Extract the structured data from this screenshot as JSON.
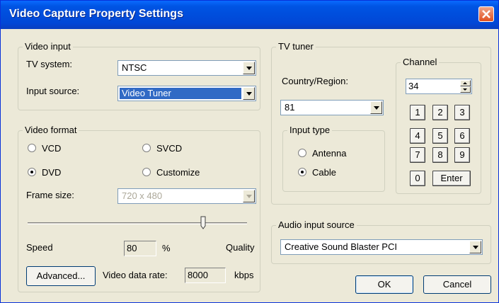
{
  "window": {
    "title": "Video Capture Property Settings"
  },
  "video_input": {
    "legend": "Video input",
    "tv_system_label": "TV system:",
    "tv_system_value": "NTSC",
    "input_source_label": "Input source:",
    "input_source_value": "Video Tuner"
  },
  "video_format": {
    "legend": "Video format",
    "options": [
      {
        "label": "VCD",
        "selected": false
      },
      {
        "label": "SVCD",
        "selected": false
      },
      {
        "label": "DVD",
        "selected": true
      },
      {
        "label": "Customize",
        "selected": false
      }
    ],
    "frame_size_label": "Frame size:",
    "frame_size_value": "720 x 480",
    "slider_value_percent": 80,
    "speed_label": "Speed",
    "quality_label": "Quality",
    "quality_value": "80",
    "percent_unit": "%",
    "advanced_label": "Advanced...",
    "data_rate_label": "Video data rate:",
    "data_rate_value": "8000",
    "data_rate_unit": "kbps"
  },
  "tv_tuner": {
    "legend": "TV tuner",
    "country_label": "Country/Region:",
    "country_value": "81",
    "input_type_legend": "Input type",
    "input_types": [
      {
        "label": "Antenna",
        "selected": false
      },
      {
        "label": "Cable",
        "selected": true
      }
    ],
    "channel_legend": "Channel",
    "channel_value": "34",
    "keys": [
      "1",
      "2",
      "3",
      "4",
      "5",
      "6",
      "7",
      "8",
      "9",
      "0"
    ],
    "enter_label": "Enter"
  },
  "audio": {
    "legend": "Audio input source",
    "value": "Creative Sound Blaster PCI"
  },
  "footer": {
    "ok_label": "OK",
    "cancel_label": "Cancel"
  },
  "colors": {
    "title_bar": "#0054e3",
    "face": "#ece9d8",
    "selection": "#316ac5",
    "close_button": "#e0501f"
  }
}
